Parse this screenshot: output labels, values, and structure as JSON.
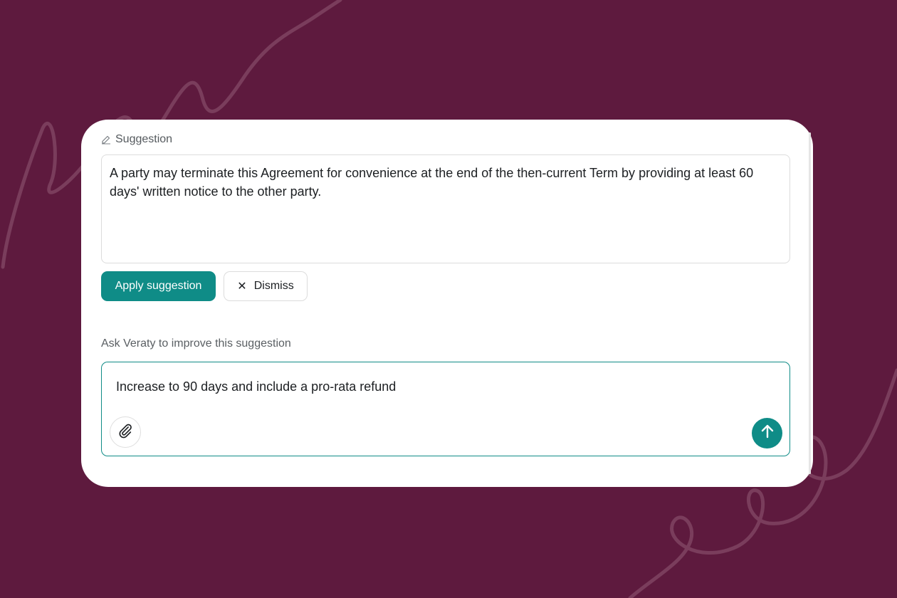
{
  "theme": {
    "background": "#5e1a3e",
    "accent": "#0f8c87",
    "card": "#ffffff"
  },
  "suggestion": {
    "label": "Suggestion",
    "label_icon": "edit-icon",
    "text": "A party may terminate this Agreement for convenience at the end of the then-current Term by providing at least 60 days' written notice to the other party."
  },
  "actions": {
    "apply_label": "Apply suggestion",
    "dismiss_label": "Dismiss",
    "dismiss_icon": "close-icon"
  },
  "ask": {
    "label": "Ask Veraty to improve this suggestion",
    "input_value": "Increase to 90 days and include a pro-rata refund",
    "attach_icon": "paperclip-icon",
    "send_icon": "arrow-up-icon"
  }
}
